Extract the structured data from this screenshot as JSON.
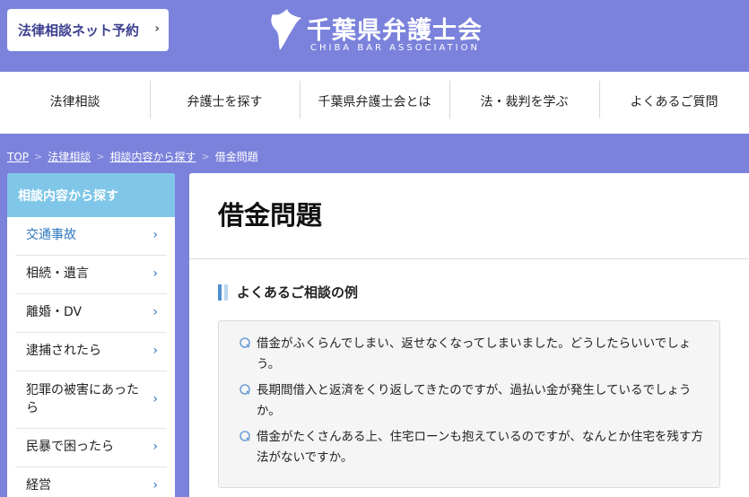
{
  "header": {
    "reserve_label": "法律相談ネット予約",
    "logo_jp": "千葉県弁護士会",
    "logo_en": "CHIBA BAR ASSOCIATION"
  },
  "nav": {
    "items": [
      {
        "label": "法律相談"
      },
      {
        "label": "弁護士を探す"
      },
      {
        "label": "千葉県弁護士会とは"
      },
      {
        "label": "法・裁判を学ぶ"
      },
      {
        "label": "よくあるご質問"
      }
    ]
  },
  "breadcrumb": {
    "top": "TOP",
    "level1": "法律相談",
    "level2": "相談内容から探す",
    "current": "借金問題",
    "sep": ">"
  },
  "sidebar": {
    "title": "相談内容から探す",
    "items": [
      {
        "label": "交通事故"
      },
      {
        "label": "相続・遺言"
      },
      {
        "label": "離婚・DV"
      },
      {
        "label": "逮捕されたら"
      },
      {
        "label": "犯罪の被害にあったら"
      },
      {
        "label": "民暴で困ったら"
      },
      {
        "label": "経営"
      }
    ]
  },
  "main": {
    "title": "借金問題",
    "section_title": "よくあるご相談の例",
    "examples": [
      "借金がふくらんでしまい、返せなくなってしまいました。どうしたらいいでしょう。",
      "長期間借入と返済をくり返してきたのですが、過払い金が発生しているでしょうか。",
      "借金がたくさんある上、住宅ローンも抱えているのですが、なんとか住宅を残す方法がないですか。"
    ]
  },
  "colors": {
    "brand": "#7b82dc",
    "sidebar_head": "#7fc6e8",
    "link_blue": "#2e76bf"
  }
}
